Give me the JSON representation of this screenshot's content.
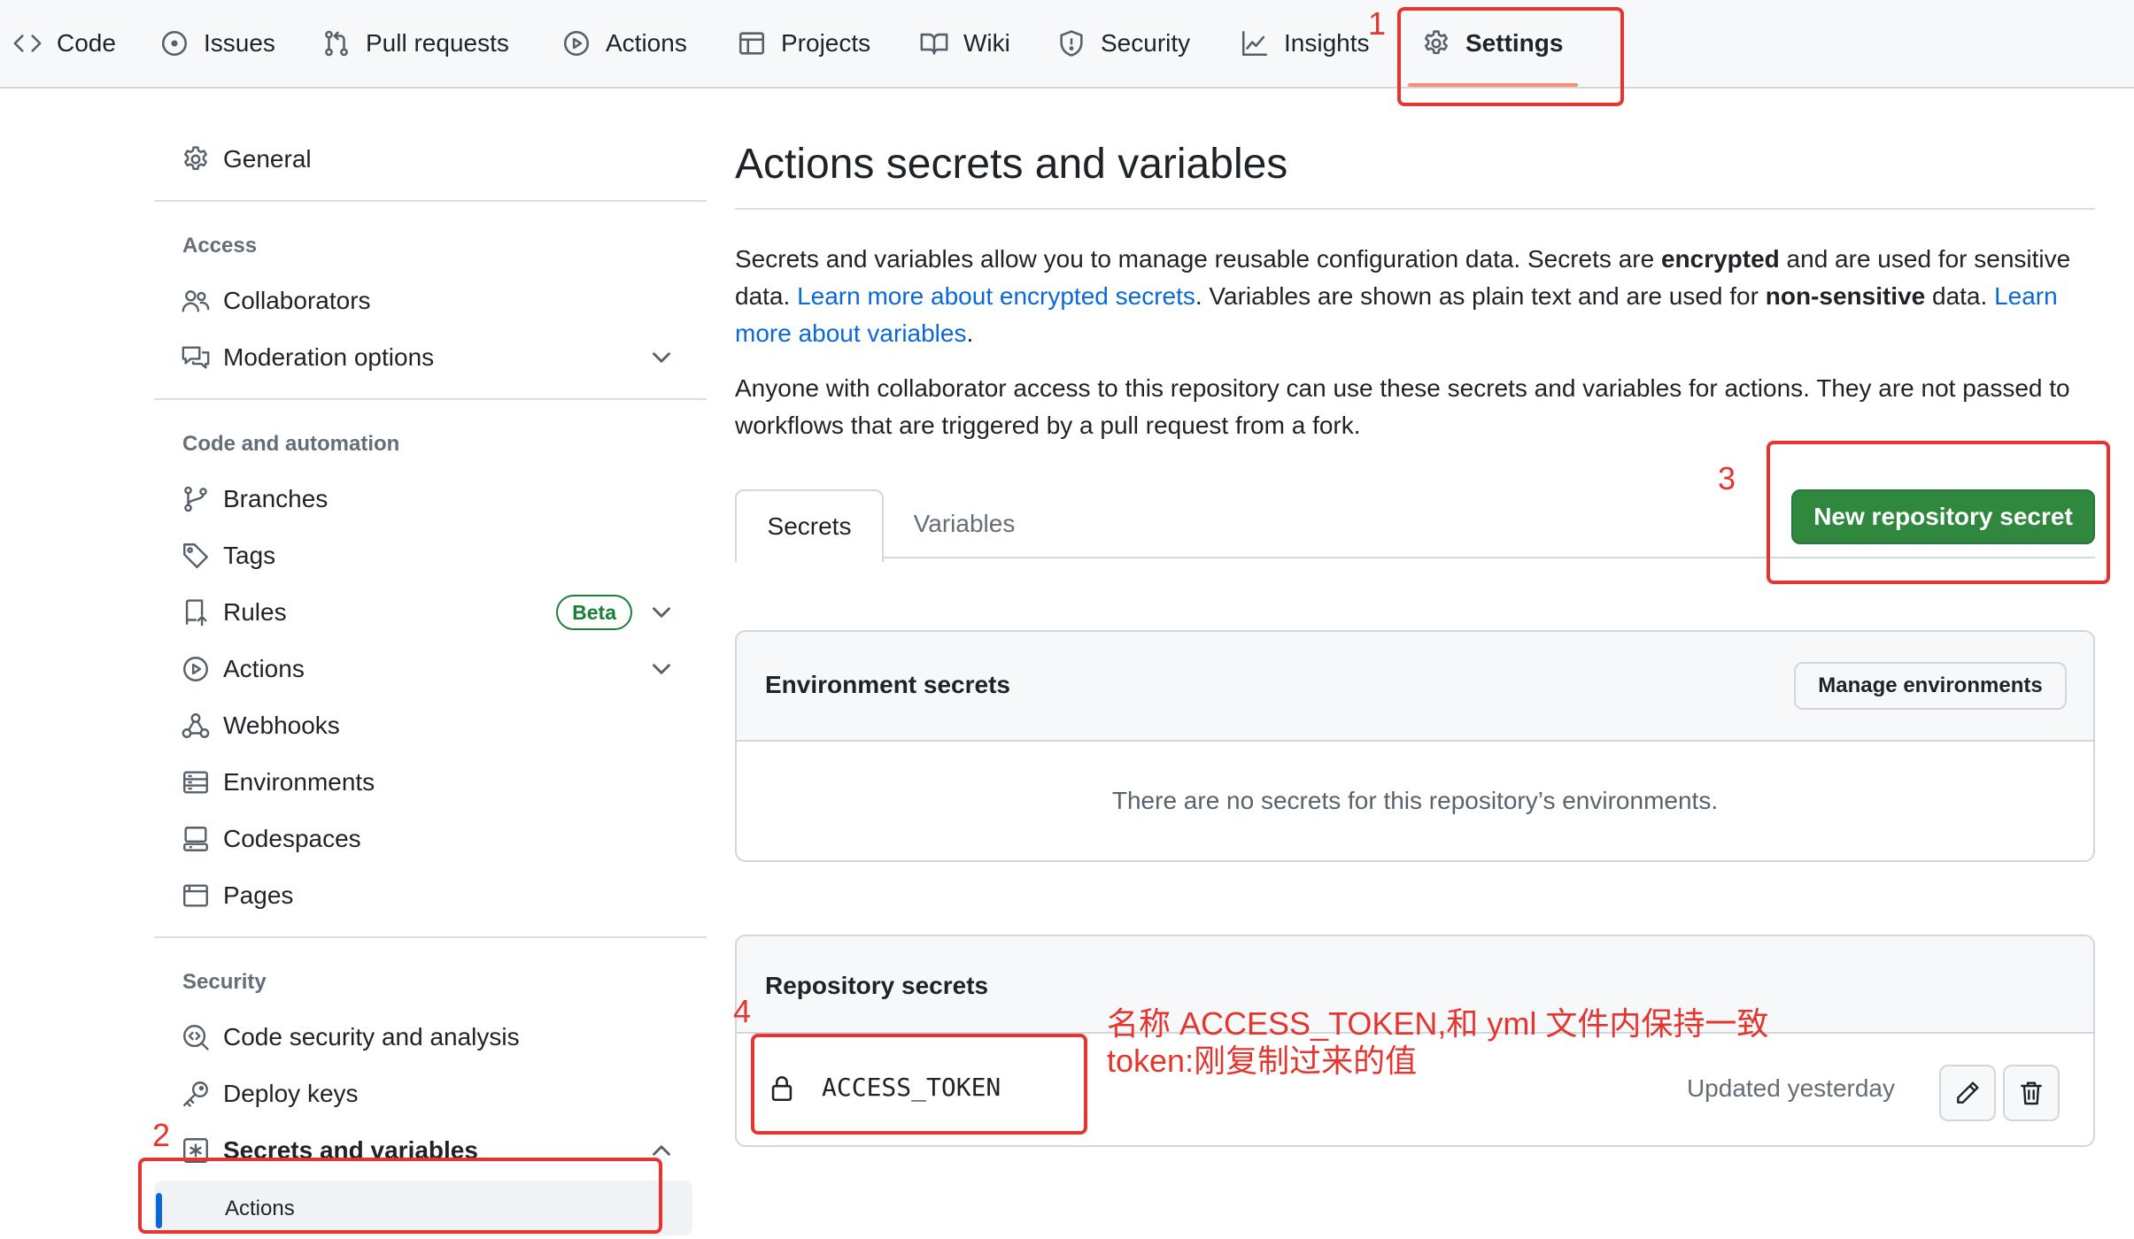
{
  "top_nav": {
    "tabs": [
      {
        "label": "Code",
        "icon": "code-icon"
      },
      {
        "label": "Issues",
        "icon": "issue-opened-icon"
      },
      {
        "label": "Pull requests",
        "icon": "git-pull-request-icon"
      },
      {
        "label": "Actions",
        "icon": "play-icon"
      },
      {
        "label": "Projects",
        "icon": "table-icon"
      },
      {
        "label": "Wiki",
        "icon": "book-icon"
      },
      {
        "label": "Security",
        "icon": "shield-icon"
      },
      {
        "label": "Insights",
        "icon": "graph-icon"
      },
      {
        "label": "Settings",
        "icon": "gear-icon",
        "selected": true
      }
    ]
  },
  "sidebar": {
    "general": "General",
    "sections": {
      "access": "Access",
      "code_automation": "Code and automation",
      "security": "Security"
    },
    "items": {
      "collaborators": "Collaborators",
      "moderation": "Moderation options",
      "branches": "Branches",
      "tags": "Tags",
      "rules": "Rules",
      "rules_badge": "Beta",
      "actions": "Actions",
      "webhooks": "Webhooks",
      "environments": "Environments",
      "codespaces": "Codespaces",
      "pages": "Pages",
      "code_security": "Code security and analysis",
      "deploy_keys": "Deploy keys",
      "secrets_variables": "Secrets and variables",
      "secrets_actions": "Actions"
    }
  },
  "main": {
    "title": "Actions secrets and variables",
    "intro": {
      "p1_a": "Secrets and variables allow you to manage reusable configuration data. Secrets are ",
      "p1_bold1": "encrypted",
      "p1_b": " and are used for sensitive data. ",
      "p1_link1": "Learn more about encrypted secrets",
      "p1_c": ". Variables are shown as plain text and are used for ",
      "p1_bold2": "non-sensitive",
      "p1_d": " data. ",
      "p1_link2": "Learn more about variables",
      "p1_e": ".",
      "p2": "Anyone with collaborator access to this repository can use these secrets and variables for actions. They are not passed to workflows that are triggered by a pull request from a fork."
    },
    "tabs": {
      "secrets": "Secrets",
      "variables": "Variables"
    },
    "new_secret_button": "New repository secret",
    "environment_secrets": {
      "title": "Environment secrets",
      "manage_button": "Manage environments",
      "empty_message": "There are no secrets for this repository’s environments."
    },
    "repository_secrets": {
      "title": "Repository secrets",
      "items": [
        {
          "name": "ACCESS_TOKEN",
          "updated": "Updated yesterday"
        }
      ]
    }
  },
  "annotations": {
    "n1": "1",
    "n2": "2",
    "n3": "3",
    "n4": "4",
    "note_line1": "名称 ACCESS_TOKEN,和 yml 文件内保持一致",
    "note_line2": "token:刚复制过来的值",
    "color": "#e5352e"
  },
  "colors": {
    "link": "#0969da",
    "primary_button": "#2f883e",
    "tab_underline": "#fd8c73",
    "beta": "#1a7f37"
  }
}
